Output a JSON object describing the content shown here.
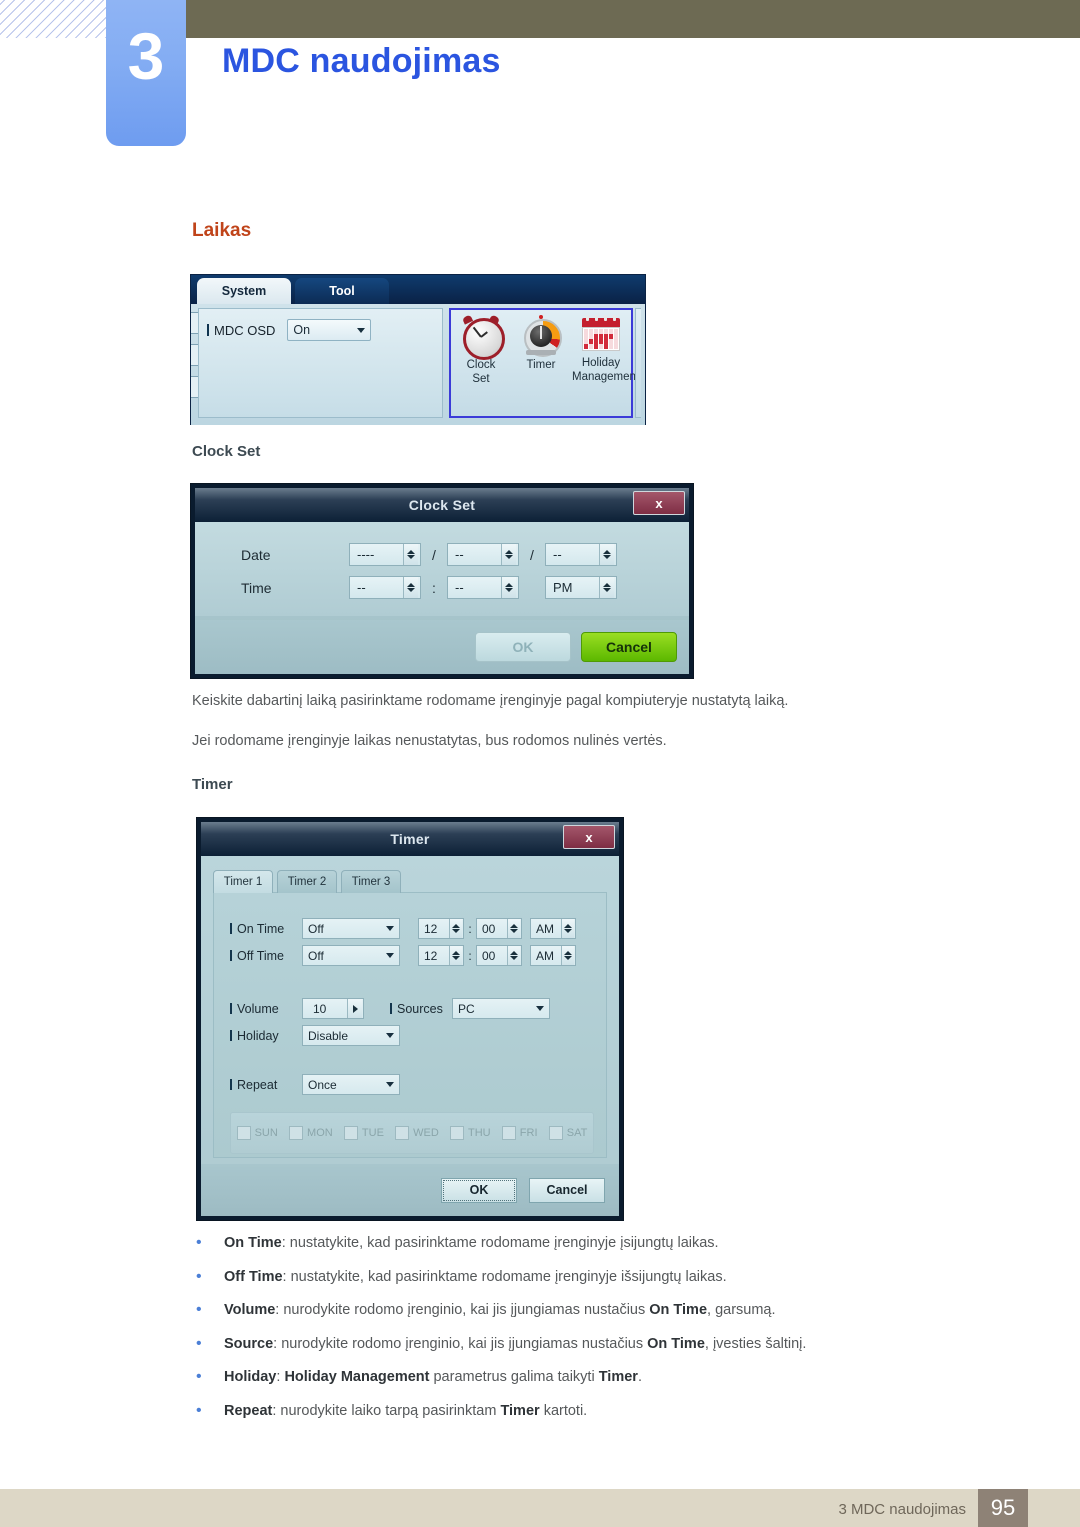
{
  "header": {
    "chapter_number": "3",
    "chapter_title": "MDC naudojimas"
  },
  "section": {
    "title": "Laikas",
    "clock_set_heading": "Clock Set",
    "timer_heading": "Timer"
  },
  "mdc_toolbar": {
    "tabs": [
      {
        "label": "System",
        "active": true
      },
      {
        "label": "Tool",
        "active": false
      }
    ],
    "osd_label": "MDC OSD",
    "osd_value": "On",
    "icons": [
      {
        "name": "clock-set-icon",
        "caption_line1": "Clock",
        "caption_line2": "Set"
      },
      {
        "name": "timer-icon",
        "caption_line1": "Timer",
        "caption_line2": ""
      },
      {
        "name": "holiday-management-icon",
        "caption_line1": "Holiday",
        "caption_line2": "Management"
      }
    ]
  },
  "clock_set_dialog": {
    "title": "Clock Set",
    "close_label": "x",
    "date_label": "Date",
    "time_label": "Time",
    "date_year": "----",
    "date_month": "--",
    "date_day": "--",
    "date_sep1": "/",
    "date_sep2": "/",
    "time_hour": "--",
    "time_minute": "--",
    "time_meridiem": "PM",
    "time_sep": ":",
    "ok_label": "OK",
    "cancel_label": "Cancel"
  },
  "paragraphs": {
    "p1": "Keiskite dabartinį laiką pasirinktame rodomame įrenginyje pagal kompiuteryje nustatytą laiką.",
    "p2": "Jei rodomame įrenginyje laikas nenustatytas, bus rodomos nulinės vertės."
  },
  "timer_dialog": {
    "title": "Timer",
    "close_label": "x",
    "tabs": [
      {
        "label": "Timer 1",
        "active": true
      },
      {
        "label": "Timer 2",
        "active": false
      },
      {
        "label": "Timer 3",
        "active": false
      }
    ],
    "on_time": {
      "label": "On Time",
      "mode": "Off",
      "hour": "12",
      "minute": "00",
      "meridiem": "AM",
      "sep": ":"
    },
    "off_time": {
      "label": "Off Time",
      "mode": "Off",
      "hour": "12",
      "minute": "00",
      "meridiem": "AM",
      "sep": ":"
    },
    "volume": {
      "label": "Volume",
      "value": "10"
    },
    "sources": {
      "label": "Sources",
      "value": "PC"
    },
    "holiday": {
      "label": "Holiday",
      "value": "Disable"
    },
    "repeat": {
      "label": "Repeat",
      "value": "Once"
    },
    "days": [
      "SUN",
      "MON",
      "TUE",
      "WED",
      "THU",
      "FRI",
      "SAT"
    ],
    "ok_label": "OK",
    "cancel_label": "Cancel"
  },
  "bullets": [
    {
      "marker": "•",
      "parts": [
        {
          "text": "On Time",
          "bold": true
        },
        {
          "text": ": nustatykite, kad pasirinktame rodomame įrenginyje įsijungtų laikas.",
          "bold": false
        }
      ]
    },
    {
      "marker": "•",
      "parts": [
        {
          "text": "Off Time",
          "bold": true
        },
        {
          "text": ": nustatykite, kad pasirinktame rodomame įrenginyje išsijungtų laikas.",
          "bold": false
        }
      ]
    },
    {
      "marker": "•",
      "parts": [
        {
          "text": "Volume",
          "bold": true
        },
        {
          "text": ": nurodykite rodomo įrenginio, kai jis įjungiamas nustačius ",
          "bold": false
        },
        {
          "text": "On Time",
          "bold": true
        },
        {
          "text": ", garsumą.",
          "bold": false
        }
      ]
    },
    {
      "marker": "•",
      "parts": [
        {
          "text": "Source",
          "bold": true
        },
        {
          "text": ": nurodykite rodomo įrenginio, kai jis įjungiamas nustačius ",
          "bold": false
        },
        {
          "text": "On Time",
          "bold": true
        },
        {
          "text": ", įvesties šaltinį.",
          "bold": false
        }
      ]
    },
    {
      "marker": "•",
      "parts": [
        {
          "text": "Holiday",
          "bold": true
        },
        {
          "text": ": ",
          "bold": false
        },
        {
          "text": "Holiday Management",
          "bold": true
        },
        {
          "text": " parametrus galima taikyti ",
          "bold": false
        },
        {
          "text": "Timer",
          "bold": true
        },
        {
          "text": ".",
          "bold": false
        }
      ]
    },
    {
      "marker": "•",
      "parts": [
        {
          "text": "Repeat",
          "bold": true
        },
        {
          "text": ": nurodykite laiko tarpą pasirinktam ",
          "bold": false
        },
        {
          "text": "Timer",
          "bold": true
        },
        {
          "text": " kartoti.",
          "bold": false
        }
      ]
    }
  ],
  "footer": {
    "text": "3 MDC naudojimas",
    "page_number": "95"
  },
  "colors": {
    "chapter_blue": "#2b55e0",
    "chapter_box": "#84adf3",
    "olive": "#6d6a53",
    "heading_orange": "#c0441a",
    "subhead": "#3d4a52",
    "body": "#55585a",
    "bullet_dot": "#4b7fd6",
    "footer_bar": "#ddd7c6",
    "page_box": "#8e8276"
  }
}
